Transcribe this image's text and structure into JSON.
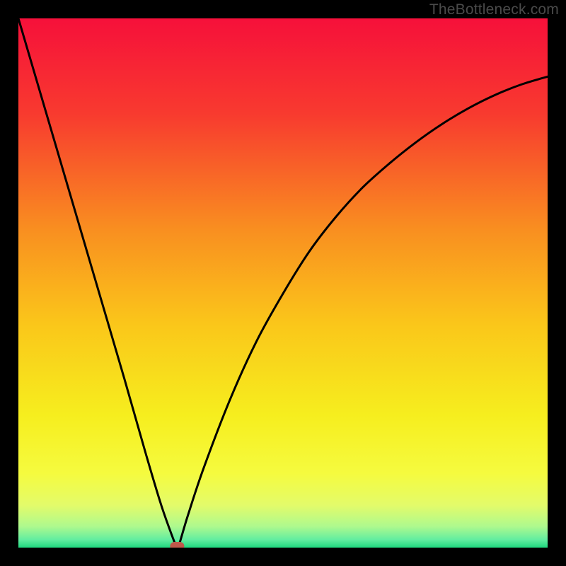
{
  "watermark": "TheBottleneck.com",
  "chart_data": {
    "type": "line",
    "title": "",
    "xlabel": "",
    "ylabel": "",
    "xlim": [
      0,
      100
    ],
    "ylim": [
      0,
      100
    ],
    "series": [
      {
        "name": "curve",
        "x": [
          0,
          5,
          10,
          15,
          20,
          24,
          27,
          29.5,
          30,
          30.5,
          32,
          35,
          40,
          45,
          50,
          55,
          60,
          65,
          70,
          75,
          80,
          85,
          90,
          95,
          100
        ],
        "values": [
          100,
          83,
          66,
          49,
          32,
          18,
          8,
          1,
          0,
          1,
          6,
          15,
          28,
          39,
          48,
          56,
          62.5,
          68,
          72.5,
          76.5,
          80,
          83,
          85.5,
          87.5,
          89
        ]
      }
    ],
    "min_marker": {
      "x": 30,
      "y": 0
    },
    "background_gradient": {
      "stops": [
        {
          "pos": 0.0,
          "color": "#f6103a"
        },
        {
          "pos": 0.18,
          "color": "#f83a2f"
        },
        {
          "pos": 0.4,
          "color": "#f98f20"
        },
        {
          "pos": 0.58,
          "color": "#fac71a"
        },
        {
          "pos": 0.75,
          "color": "#f6ee1e"
        },
        {
          "pos": 0.86,
          "color": "#f5fb3f"
        },
        {
          "pos": 0.92,
          "color": "#e3fb6a"
        },
        {
          "pos": 0.96,
          "color": "#aef98e"
        },
        {
          "pos": 0.985,
          "color": "#62eda0"
        },
        {
          "pos": 1.0,
          "color": "#1fd77e"
        }
      ]
    }
  }
}
